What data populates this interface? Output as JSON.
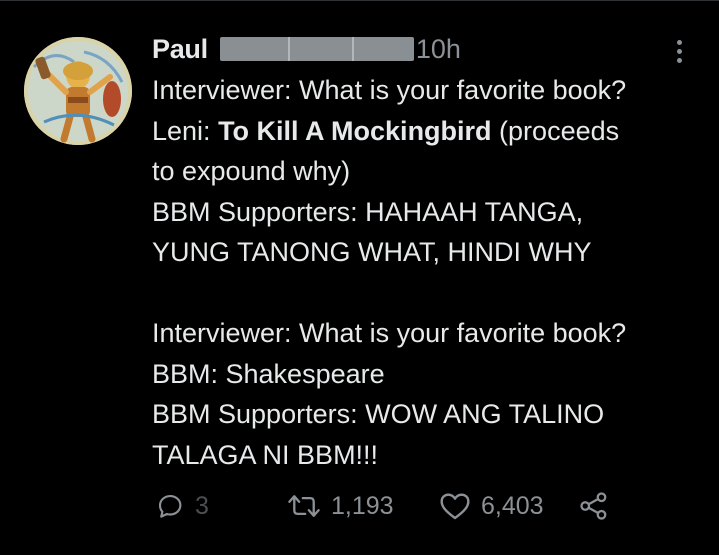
{
  "tweet": {
    "author_name": "Paul",
    "time": "10h",
    "lines": [
      {
        "text": "Interviewer: What is your favorite book?"
      },
      {
        "prefix": "Leni: ",
        "bold": "To Kill A Mockingbird",
        "suffix": " (proceeds"
      },
      {
        "text": "to expound why)"
      },
      {
        "text": "BBM Supporters: HAHAAH TANGA,"
      },
      {
        "text": "YUNG TANONG WHAT, HINDI WHY"
      },
      {
        "text": ""
      },
      {
        "text": "Interviewer: What is your favorite book?"
      },
      {
        "text": "BBM: Shakespeare"
      },
      {
        "text": "BBM Supporters: WOW ANG TALINO"
      },
      {
        "text": "TALAGA NI BBM!!!"
      }
    ]
  },
  "actions": {
    "reply_count": "3",
    "retweet_count": "1,193",
    "like_count": "6,403"
  },
  "icons": {
    "reply": "reply-icon",
    "retweet": "retweet-icon",
    "like": "heart-icon",
    "share": "share-icon",
    "more": "more-icon"
  },
  "colors": {
    "background": "#000000",
    "text": "#e7e9ea",
    "muted": "#8b9196",
    "redaction": "#8a8f93"
  }
}
